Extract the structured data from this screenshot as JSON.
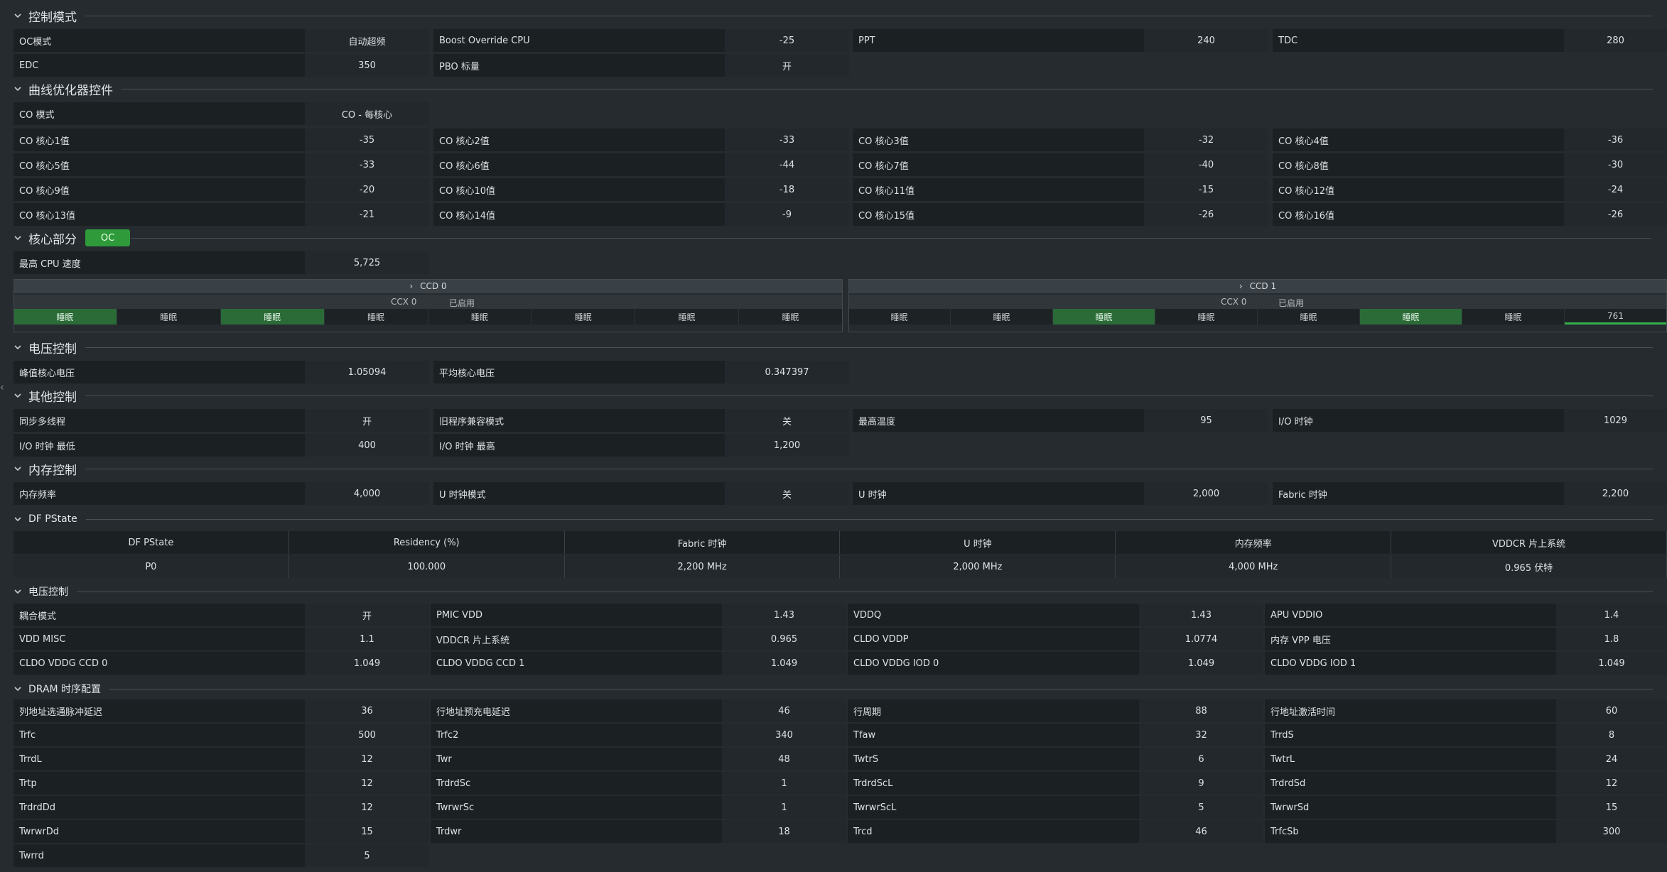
{
  "sections": {
    "control_mode": "控制模式",
    "curve_optimizer": "曲线优化器控件",
    "core_section": "核心部分",
    "core_badge": "OC",
    "voltage_control": "电压控制",
    "other_control": "其他控制",
    "memory_control": "内存控制",
    "df_pstate": "DF PState",
    "mem_voltage_control": "电压控制",
    "dram_timing": "DRAM 时序配置"
  },
  "control_mode": [
    {
      "label": "OC模式",
      "value": "自动超频"
    },
    {
      "label": "Boost Override CPU",
      "value": "-25"
    },
    {
      "label": "PPT",
      "value": "240"
    },
    {
      "label": "TDC",
      "value": "280"
    },
    {
      "label": "EDC",
      "value": "350"
    },
    {
      "label": "PBO 标量",
      "value": "开"
    }
  ],
  "curve_optimizer": {
    "mode_label": "CO 模式",
    "mode_value": "CO - 每核心",
    "cores": [
      {
        "label": "CO 核心1值",
        "value": "-35"
      },
      {
        "label": "CO 核心2值",
        "value": "-33"
      },
      {
        "label": "CO 核心3值",
        "value": "-32"
      },
      {
        "label": "CO 核心4值",
        "value": "-36"
      },
      {
        "label": "CO 核心5值",
        "value": "-33"
      },
      {
        "label": "CO 核心6值",
        "value": "-44"
      },
      {
        "label": "CO 核心7值",
        "value": "-40"
      },
      {
        "label": "CO 核心8值",
        "value": "-30"
      },
      {
        "label": "CO 核心9值",
        "value": "-20"
      },
      {
        "label": "CO 核心10值",
        "value": "-18"
      },
      {
        "label": "CO 核心11值",
        "value": "-15"
      },
      {
        "label": "CO 核心12值",
        "value": "-24"
      },
      {
        "label": "CO 核心13值",
        "value": "-21"
      },
      {
        "label": "CO 核心14值",
        "value": "-9"
      },
      {
        "label": "CO 核心15值",
        "value": "-26"
      },
      {
        "label": "CO 核心16值",
        "value": "-26"
      }
    ]
  },
  "core_section": {
    "max_cpu_label": "最高 CPU 速度",
    "max_cpu_value": "5,725",
    "ccd0": {
      "title": "CCD 0",
      "ccx": "CCX 0",
      "ccx_state": "已启用",
      "cores": [
        "睡眠",
        "睡眠",
        "睡眠",
        "睡眠",
        "睡眠",
        "睡眠",
        "睡眠",
        "睡眠"
      ]
    },
    "ccd1": {
      "title": "CCD 1",
      "ccx": "CCX 0",
      "ccx_state": "已启用",
      "cores": [
        "睡眠",
        "睡眠",
        "睡眠",
        "睡眠",
        "睡眠",
        "睡眠",
        "睡眠",
        "761"
      ]
    }
  },
  "voltage_control": [
    {
      "label": "峰值核心电压",
      "value": "1.05094"
    },
    {
      "label": "平均核心电压",
      "value": "0.347397"
    }
  ],
  "other_control": [
    {
      "label": "同步多线程",
      "value": "开"
    },
    {
      "label": "旧程序兼容模式",
      "value": "关"
    },
    {
      "label": "最高温度",
      "value": "95"
    },
    {
      "label": "I/O 时钟",
      "value": "1029"
    },
    {
      "label": "I/O 时钟 最低",
      "value": "400"
    },
    {
      "label": "I/O 时钟 最高",
      "value": "1,200"
    }
  ],
  "memory_control": [
    {
      "label": "内存频率",
      "value": "4,000"
    },
    {
      "label": "U 时钟模式",
      "value": "关"
    },
    {
      "label": "U 时钟",
      "value": "2,000"
    },
    {
      "label": "Fabric 时钟",
      "value": "2,200"
    }
  ],
  "df_pstate": {
    "headers": [
      "DF PState",
      "Residency (%)",
      "Fabric 时钟",
      "U 时钟",
      "内存频率",
      "VDDCR 片上系统"
    ],
    "row": [
      "P0",
      "100.000",
      "2,200 MHz",
      "2,000 MHz",
      "4,000 MHz",
      "0.965 伏特"
    ]
  },
  "mem_voltage": [
    {
      "label": "耦合模式",
      "value": "开"
    },
    {
      "label": "PMIC VDD",
      "value": "1.43"
    },
    {
      "label": "VDDQ",
      "value": "1.43"
    },
    {
      "label": "APU VDDIO",
      "value": "1.4"
    },
    {
      "label": "VDD MISC",
      "value": "1.1"
    },
    {
      "label": "VDDCR 片上系统",
      "value": "0.965"
    },
    {
      "label": "CLDO VDDP",
      "value": "1.0774"
    },
    {
      "label": "内存 VPP 电压",
      "value": "1.8"
    },
    {
      "label": "CLDO VDDG CCD 0",
      "value": "1.049"
    },
    {
      "label": "CLDO VDDG CCD 1",
      "value": "1.049"
    },
    {
      "label": "CLDO VDDG IOD 0",
      "value": "1.049"
    },
    {
      "label": "CLDO VDDG IOD 1",
      "value": "1.049"
    }
  ],
  "dram_timing": [
    {
      "label": "列地址选通脉冲延迟",
      "value": "36"
    },
    {
      "label": "行地址预充电延迟",
      "value": "46"
    },
    {
      "label": "行周期",
      "value": "88"
    },
    {
      "label": "行地址激活时间",
      "value": "60"
    },
    {
      "label": "Trfc",
      "value": "500"
    },
    {
      "label": "Trfc2",
      "value": "340"
    },
    {
      "label": "Tfaw",
      "value": "32"
    },
    {
      "label": "TrrdS",
      "value": "8"
    },
    {
      "label": "TrrdL",
      "value": "12"
    },
    {
      "label": "Twr",
      "value": "48"
    },
    {
      "label": "TwtrS",
      "value": "6"
    },
    {
      "label": "TwtrL",
      "value": "24"
    },
    {
      "label": "Trtp",
      "value": "12"
    },
    {
      "label": "TrdrdSc",
      "value": "1"
    },
    {
      "label": "TrdrdScL",
      "value": "9"
    },
    {
      "label": "TrdrdSd",
      "value": "12"
    },
    {
      "label": "TrdrdDd",
      "value": "12"
    },
    {
      "label": "TwrwrSc",
      "value": "1"
    },
    {
      "label": "TwrwrScL",
      "value": "5"
    },
    {
      "label": "TwrwrSd",
      "value": "15"
    },
    {
      "label": "TwrwrDd",
      "value": "15"
    },
    {
      "label": "Trdwr",
      "value": "18"
    },
    {
      "label": "Trcd",
      "value": "46"
    },
    {
      "label": "TrfcSb",
      "value": "300"
    },
    {
      "label": "Twrrd",
      "value": "5"
    }
  ]
}
